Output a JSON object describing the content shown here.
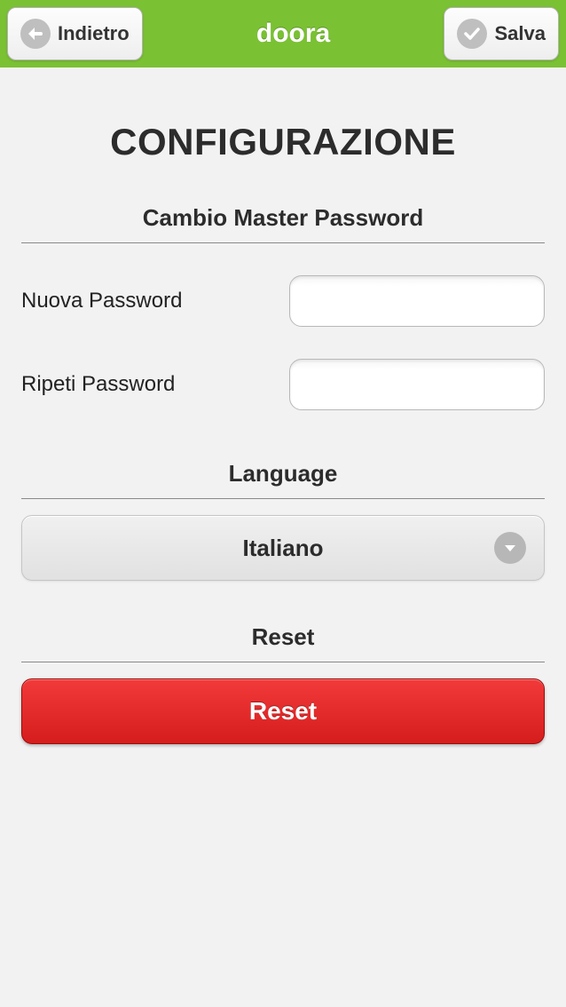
{
  "header": {
    "back_label": "Indietro",
    "app_title": "doora",
    "save_label": "Salva"
  },
  "page": {
    "title": "CONFIGURAZIONE"
  },
  "password_section": {
    "title": "Cambio Master Password",
    "new_label": "Nuova Password",
    "new_value": "",
    "repeat_label": "Ripeti Password",
    "repeat_value": ""
  },
  "language_section": {
    "title": "Language",
    "selected": "Italiano"
  },
  "reset_section": {
    "title": "Reset",
    "button_label": "Reset"
  }
}
